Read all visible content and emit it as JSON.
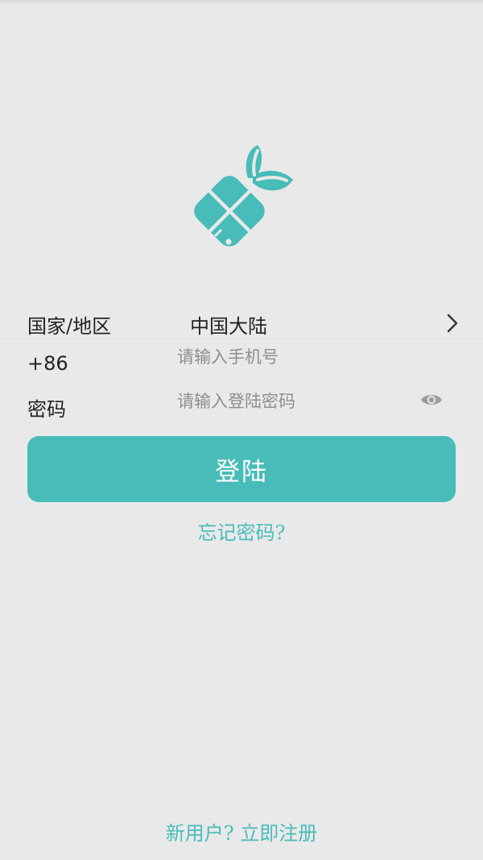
{
  "login": {
    "region_label": "国家/地区",
    "region_value": "中国大陆",
    "phone_prefix": "+86",
    "phone_placeholder": "请输入手机号",
    "password_label": "密码",
    "password_placeholder": "请输入登陆密码",
    "login_button": "登陆",
    "forgot_password": "忘记密码?",
    "register_link": "新用户? 立即注册"
  },
  "icons": {
    "logo": "fish-window-logo",
    "region_chevron": "chevron-right-icon",
    "password_toggle": "eye-icon"
  },
  "colors": {
    "accent": "#48bcb9",
    "background": "#e9e9e9"
  }
}
